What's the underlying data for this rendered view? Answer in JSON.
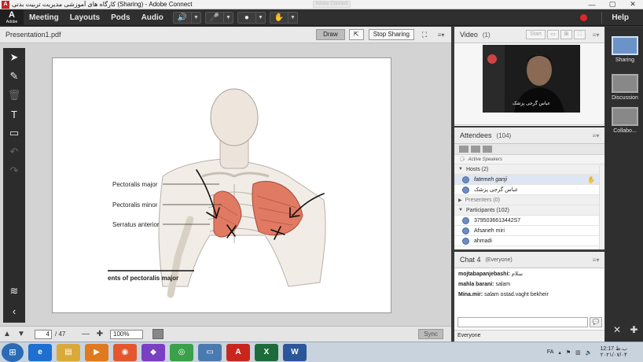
{
  "window": {
    "title": "کارگاه های آموزشی مدیریت تربیت بدنی (Sharing) - Adobe Connect",
    "faded_tab": "Adobe Connect"
  },
  "menubar": {
    "logo_text": "Adobe",
    "items": [
      "Meeting",
      "Layouts",
      "Pods",
      "Audio"
    ],
    "help": "Help"
  },
  "share_pod": {
    "title": "Presentation1.pdf",
    "draw_label": "Draw",
    "stop_sharing_label": "Stop Sharing",
    "page_current": "4",
    "page_total": "/ 47",
    "zoom": "100%",
    "sync_label": "Sync"
  },
  "slide": {
    "labels": [
      "Pectoralis major",
      "Pectoralis minor",
      "Serratus anterior"
    ],
    "caption": "ents of pectoralis major"
  },
  "video_pod": {
    "title": "Video",
    "count": "(1)",
    "start_label": "Start",
    "camera_name": "عباس گرجی پزشک"
  },
  "attendees": {
    "title": "Attendees",
    "count": "(104)",
    "active_speakers": "Active Speakers",
    "hosts_label": "Hosts (2)",
    "hosts": [
      "fatemeh ganji",
      "عباس گرجی پزشک"
    ],
    "presenters_label": "Presenters (0)",
    "participants_label": "Participants (102)",
    "participants": [
      "3795036613442S7",
      "Afsaneh miri",
      "ahmadi"
    ]
  },
  "chat": {
    "title": "Chat 4",
    "scope": "(Everyone)",
    "messages": [
      {
        "sender": "mojtabapanjebashi:",
        "text": " سلام"
      },
      {
        "sender": "mahla barani:",
        "text": " salam"
      },
      {
        "sender": "Mina.mir:",
        "text": " salam ostad.vaght bekheir"
      }
    ],
    "footer": "Everyone"
  },
  "layouts": {
    "items": [
      "Sharing",
      "Discussion",
      "Collabo..."
    ]
  },
  "taskbar": {
    "lang": "FA",
    "time": "12:17 ب.ظ",
    "date": "۲۰۲۱/۰۷/۰۴"
  },
  "colors": {
    "accent": "#6b93c8",
    "record": "#e0262b",
    "audio_active": "#61d13c"
  }
}
